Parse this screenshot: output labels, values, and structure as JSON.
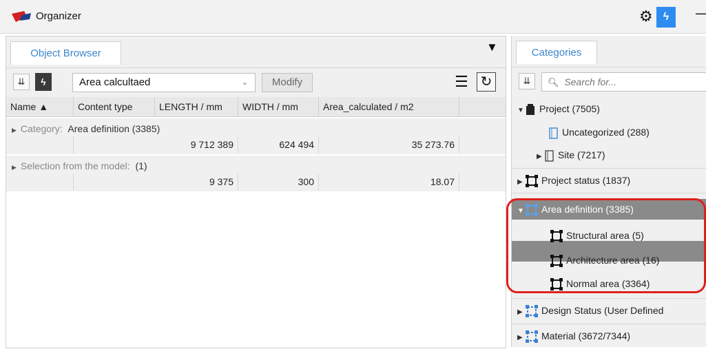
{
  "app": {
    "title": "Organizer",
    "icons": {
      "logo": "organizer-logo-icon",
      "settings": "gear-icon",
      "mode": "lightning-icon",
      "minimize": "minimize-icon"
    },
    "accent": "#2e8cf0"
  },
  "left_panel": {
    "tab_label": "Object Browser",
    "toolbar": {
      "property_set": "Area calcultaed",
      "modify_label": "Modify"
    },
    "columns": [
      "Name ▲",
      "Content type",
      "LENGTH / mm",
      "WIDTH / mm",
      "Area_calculated / m2"
    ],
    "groups": [
      {
        "prefix": "Category:",
        "name": "Area definition (3385)",
        "values": [
          "9 712 389",
          "624 494",
          "35 273.76"
        ]
      },
      {
        "prefix": "Selection from the model:",
        "name": "(1)",
        "values": [
          "9 375",
          "300",
          "18.07"
        ]
      }
    ]
  },
  "right_panel": {
    "tab_label": "Categories",
    "search_placeholder": "Search for...",
    "tree": [
      {
        "label": "Project (7505)",
        "level": 0,
        "expanded": true,
        "icon": "project-icon"
      },
      {
        "label": "Uncategorized (288)",
        "level": 1,
        "expanded": null,
        "icon": "document-icon"
      },
      {
        "label": "Site (7217)",
        "level": 1,
        "expanded": false,
        "icon": "document-icon"
      },
      {
        "label": "Project status (1837)",
        "level": 0,
        "expanded": false,
        "icon": "area-icon"
      },
      {
        "label": "Area definition (3385)",
        "level": 0,
        "expanded": true,
        "selected": true,
        "icon": "area-icon"
      },
      {
        "label": "Structural area (5)",
        "level": 1,
        "icon": "area-icon"
      },
      {
        "label": "Architecture area (16)",
        "level": 1,
        "icon": "area-icon"
      },
      {
        "label": "Normal area (3364)",
        "level": 1,
        "icon": "area-icon"
      },
      {
        "label": "Design Status (User Defined",
        "level": 0,
        "expanded": false,
        "icon": "area-blue-icon"
      },
      {
        "label": "Material (3672/7344)",
        "level": 0,
        "expanded": false,
        "icon": "area-blue-icon"
      }
    ]
  },
  "highlight_color": "#e0201c"
}
